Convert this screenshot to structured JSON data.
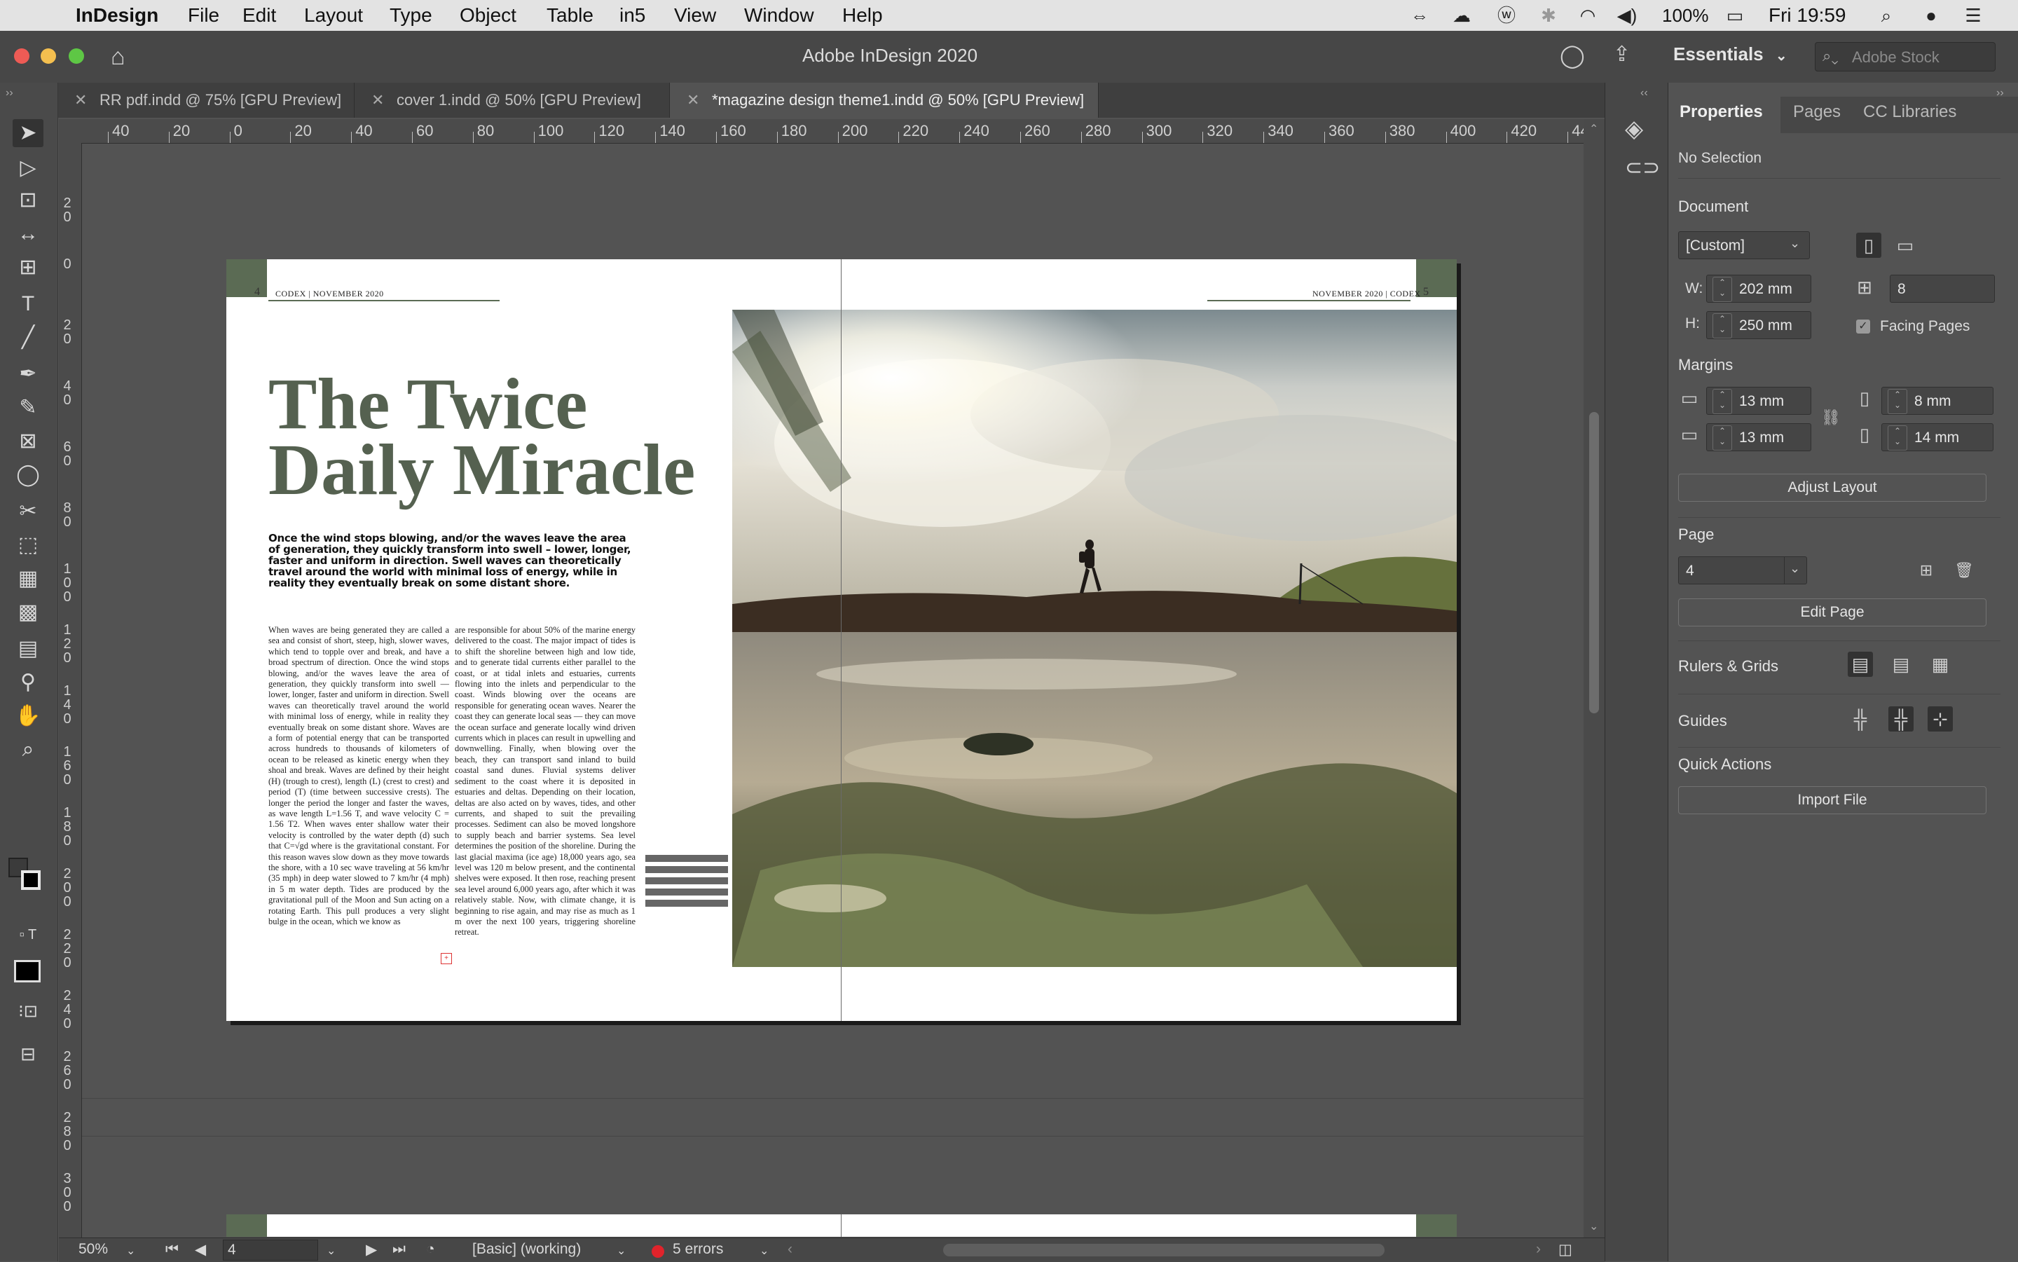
{
  "menubar": {
    "app_name": "InDesign",
    "items": [
      "File",
      "Edit",
      "Layout",
      "Type",
      "Object",
      "Table",
      "in5",
      "View",
      "Window",
      "Help"
    ],
    "battery": "100%",
    "clock": "Fri 19:59"
  },
  "window": {
    "title": "Adobe InDesign 2020",
    "workspace": "Essentials",
    "stock_placeholder": "Adobe Stock"
  },
  "tabs": [
    {
      "label": "RR pdf.indd @ 75% [GPU Preview]",
      "active": false
    },
    {
      "label": "cover 1.indd @ 50% [GPU Preview]",
      "active": false
    },
    {
      "label": "*magazine design theme1.indd @ 50% [GPU Preview]",
      "active": true
    }
  ],
  "ruler": {
    "h_ticks": [
      "40",
      "20",
      "0",
      "20",
      "40",
      "60",
      "80",
      "100",
      "120",
      "140",
      "160",
      "180",
      "200",
      "220",
      "240",
      "260",
      "280",
      "300",
      "320",
      "340",
      "360",
      "380",
      "400",
      "420",
      "44"
    ],
    "v_ticks": [
      "2\n0",
      "0",
      "2\n0",
      "4\n0",
      "6\n0",
      "8\n0",
      "1\n0\n0",
      "1\n2\n0",
      "1\n4\n0",
      "1\n6\n0",
      "1\n8\n0",
      "2\n0\n0",
      "2\n2\n0",
      "2\n4\n0",
      "2\n6\n0",
      "2\n8\n0",
      "3\n0\n0"
    ]
  },
  "document": {
    "left_page_num": "4",
    "right_page_num": "5",
    "left_folio": "CODEX | NOVEMBER 2020",
    "right_folio": "NOVEMBER 2020 | CODEX",
    "headline": "The Twice Daily Miracle",
    "deck": "Once the wind stops blowing, and/or the waves leave the area of generation, they quickly transform into swell – lower, longer, faster and uniform in direction. Swell waves can theoretically travel around the world with minimal loss of energy, while in reality they eventually break on some distant shore.",
    "col1": "When waves are being generated they are called a sea and consist of short, steep, high, slower waves, which tend to topple over and break, and have a broad spectrum of direction. Once the wind stops blowing, and/or the waves leave the area of generation, they quickly transform into swell — lower, longer, faster and uniform in direction. Swell waves can theoretically travel around the world with minimal loss of energy, while in reality they eventually break on some distant shore. Waves are a form of potential energy that can be transported across hundreds to thousands of kilometers of ocean to be released as kinetic energy when they shoal and break. Waves are defined by their height (H) (trough to crest), length (L) (crest to crest) and period (T) (time between successive crests). The longer the period the longer and faster the waves, as wave length L=1.56 T, and wave velocity C = 1.56 T2. When waves enter shallow water their velocity is controlled by the water depth (d) such that C=√gd where is the gravitational constant. For this reason waves slow down as they move towards the shore, with a 10 sec wave traveling at 56 km/hr (35 mph) in deep water slowed to 7 km/hr (4 mph) in 5 m water depth. Tides are produced by the gravitational pull of the Moon and Sun acting on a rotating Earth. This pull produces a very slight bulge in the ocean, which we know as",
    "col2": "are responsible for about 50% of the marine energy delivered to the coast. The major impact of tides is to shift the shoreline between high and low tide, and to generate tidal currents either parallel to the coast, or at tidal inlets and estuaries, currents flowing into the inlets and perpendicular to the coast. Winds blowing over the oceans are responsible for generating ocean waves. Nearer the coast they can generate local seas — they can move the ocean surface and generate locally wind driven currents which in places can result in upwelling and downwelling. Finally, when blowing over the beach, they can transport sand inland to build coastal sand dunes. Fluvial systems deliver sediment to the coast where it is deposited in estuaries and deltas. Depending on their location, deltas are also acted on by waves, tides, and other currents, and shaped to suit the prevailing processes. Sediment can also be moved longshore to supply beach and barrier systems. Sea level determines the position of the shoreline. During the last glacial maxima (ice age) 18,000 years ago, sea level was 120 m below present, and the continental shelves were exposed. It then rose, reaching present sea level around 6,000 years ago, after which it was relatively stable. Now, with climate change, it is beginning to rise again, and may rise as much as 1 m over the next 100 years, triggering shoreline retreat."
  },
  "panel": {
    "tabs": [
      "Properties",
      "Pages",
      "CC Libraries"
    ],
    "selection": "No Selection",
    "document_heading": "Document",
    "preset": "[Custom]",
    "w_label": "W:",
    "w_value": "202 mm",
    "h_label": "H:",
    "h_value": "250 mm",
    "pages_count": "8",
    "facing_pages": "Facing Pages",
    "margins_heading": "Margins",
    "margin_top": "13 mm",
    "margin_bottom": "13 mm",
    "margin_inside": "8 mm",
    "margin_outside": "14 mm",
    "adjust_layout": "Adjust Layout",
    "page_heading": "Page",
    "page_value": "4",
    "edit_page": "Edit Page",
    "rulers_grids": "Rulers & Grids",
    "guides": "Guides",
    "quick_actions": "Quick Actions",
    "import_file": "Import File"
  },
  "status": {
    "zoom": "50%",
    "page": "4",
    "preflight_profile": "[Basic] (working)",
    "errors": "5 errors",
    "error_color": "#e0232b"
  },
  "colors": {
    "accent_green": "#5b6b54",
    "headline_green": "#556150"
  }
}
